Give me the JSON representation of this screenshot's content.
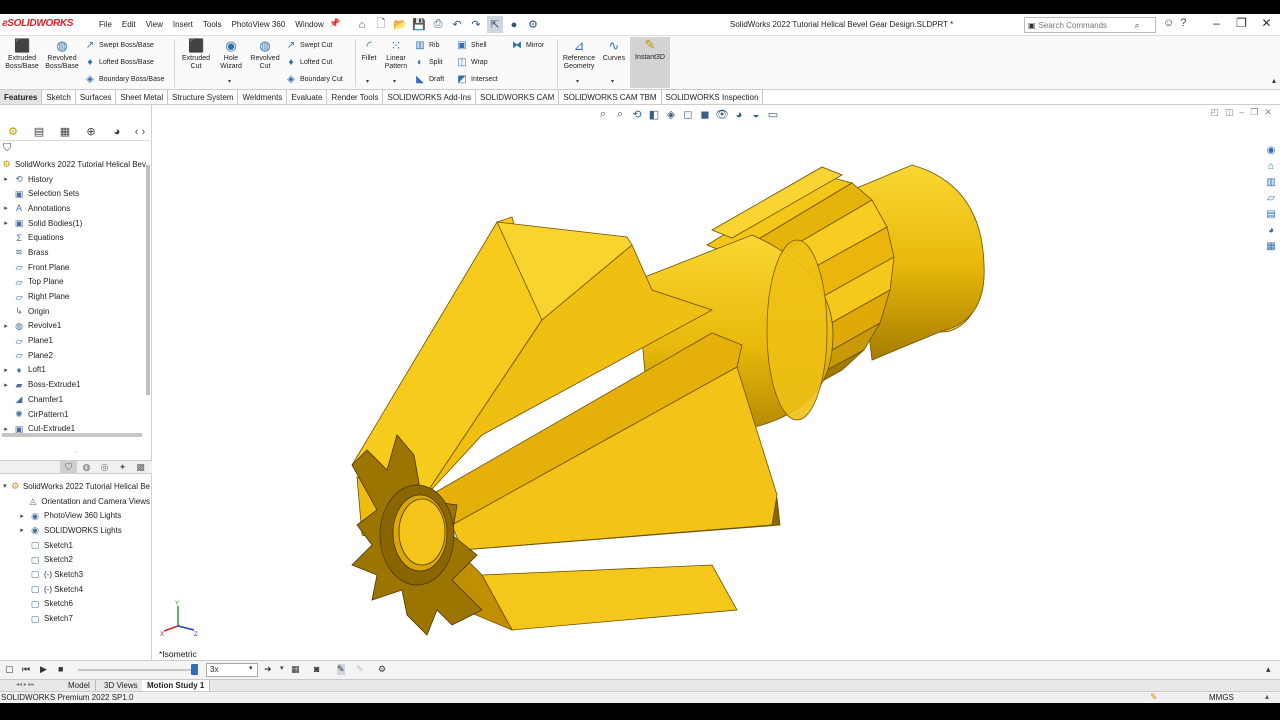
{
  "app": {
    "logo": "SOLIDWORKS",
    "menus": [
      "File",
      "Edit",
      "View",
      "Insert",
      "Tools",
      "PhotoView 360",
      "Window"
    ],
    "document_title": "SolidWorks 2022 Tutorial Helical Bevel Gear Design.SLDPRT *",
    "search_placeholder": "Search Commands",
    "quick_access_icons": [
      "home-icon",
      "new-icon",
      "open-icon",
      "save-icon",
      "print-icon",
      "undo-icon",
      "redo-icon",
      "select-icon",
      "rebuild-icon",
      "options-icon"
    ]
  },
  "ribbon": {
    "extruded_boss": "Extruded Boss/Base",
    "revolved_boss": "Revolved Boss/Base",
    "swept_boss": "Swept Boss/Base",
    "lofted_boss": "Lofted Boss/Base",
    "boundary_boss": "Boundary Boss/Base",
    "extruded_cut": "Extruded Cut",
    "hole_wizard": "Hole Wizard",
    "revolved_cut": "Revolved Cut",
    "swept_cut": "Swept Cut",
    "lofted_cut": "Lofted Cut",
    "boundary_cut": "Boundary Cut",
    "fillet": "Fillet",
    "linear_pattern": "Linear Pattern",
    "rib": "Rib",
    "split": "Split",
    "draft": "Draft",
    "shell": "Shell",
    "wrap": "Wrap",
    "intersect": "Intersect",
    "mirror": "Mirror",
    "reference_geometry": "Reference Geometry",
    "curves": "Curves",
    "instant3d": "Instant3D"
  },
  "command_tabs": [
    "Features",
    "Sketch",
    "Surfaces",
    "Sheet Metal",
    "Structure System",
    "Weldments",
    "Evaluate",
    "Render Tools",
    "SOLIDWORKS Add-Ins",
    "SOLIDWORKS CAM",
    "SOLIDWORKS CAM TBM",
    "SOLIDWORKS Inspection"
  ],
  "feature_tree": {
    "root": "SolidWorks 2022 Tutorial Helical Bev",
    "items": [
      {
        "label": "History",
        "icon": "history-icon",
        "expandable": true
      },
      {
        "label": "Selection Sets",
        "icon": "selection-sets-icon",
        "expandable": false
      },
      {
        "label": "Annotations",
        "icon": "annotations-icon",
        "expandable": true
      },
      {
        "label": "Solid Bodies(1)",
        "icon": "solid-bodies-icon",
        "expandable": true
      },
      {
        "label": "Equations",
        "icon": "equations-icon",
        "expandable": false
      },
      {
        "label": "Brass",
        "icon": "material-icon",
        "expandable": false
      },
      {
        "label": "Front Plane",
        "icon": "plane-icon",
        "expandable": false
      },
      {
        "label": "Top Plane",
        "icon": "plane-icon",
        "expandable": false
      },
      {
        "label": "Right Plane",
        "icon": "plane-icon",
        "expandable": false
      },
      {
        "label": "Origin",
        "icon": "origin-icon",
        "expandable": false
      },
      {
        "label": "Revolve1",
        "icon": "revolve-icon",
        "expandable": true
      },
      {
        "label": "Plane1",
        "icon": "plane-icon",
        "expandable": false
      },
      {
        "label": "Plane2",
        "icon": "plane-icon",
        "expandable": false
      },
      {
        "label": "Loft1",
        "icon": "loft-icon",
        "expandable": true
      },
      {
        "label": "Boss-Extrude1",
        "icon": "extrude-icon",
        "expandable": true
      },
      {
        "label": "Chamfer1",
        "icon": "chamfer-icon",
        "expandable": false
      },
      {
        "label": "CirPattern1",
        "icon": "circular-pattern-icon",
        "expandable": false
      },
      {
        "label": "Cut-Extrude1",
        "icon": "cut-extrude-icon",
        "expandable": true
      }
    ]
  },
  "display_manager": {
    "root": "SolidWorks 2022 Tutorial Helical Be",
    "items": [
      {
        "label": "Orientation and Camera Views",
        "icon": "camera-icon",
        "expandable": false
      },
      {
        "label": "PhotoView 360 Lights",
        "icon": "lights-icon",
        "expandable": true
      },
      {
        "label": "SOLIDWORKS Lights",
        "icon": "lights-icon",
        "expandable": true
      },
      {
        "label": "Sketch1",
        "icon": "sketch-icon",
        "expandable": false
      },
      {
        "label": "Sketch2",
        "icon": "sketch-icon",
        "expandable": false
      },
      {
        "label": "(-) Sketch3",
        "icon": "sketch-icon",
        "expandable": false
      },
      {
        "label": "(-) Sketch4",
        "icon": "sketch-icon",
        "expandable": false
      },
      {
        "label": "Sketch6",
        "icon": "sketch-icon",
        "expandable": false
      },
      {
        "label": "Sketch7",
        "icon": "sketch-icon",
        "expandable": false
      }
    ]
  },
  "viewport": {
    "view_label": "*Isometric",
    "model_color": "#f4c51a",
    "model_shadow": "#7a5c00"
  },
  "motion": {
    "speed": "3x",
    "progress": 0.97
  },
  "bottom_tabs": [
    "Model",
    "3D Views",
    "Motion Study 1"
  ],
  "status": {
    "version": "SOLIDWORKS Premium 2022 SP1.0",
    "units": "MMGS"
  }
}
